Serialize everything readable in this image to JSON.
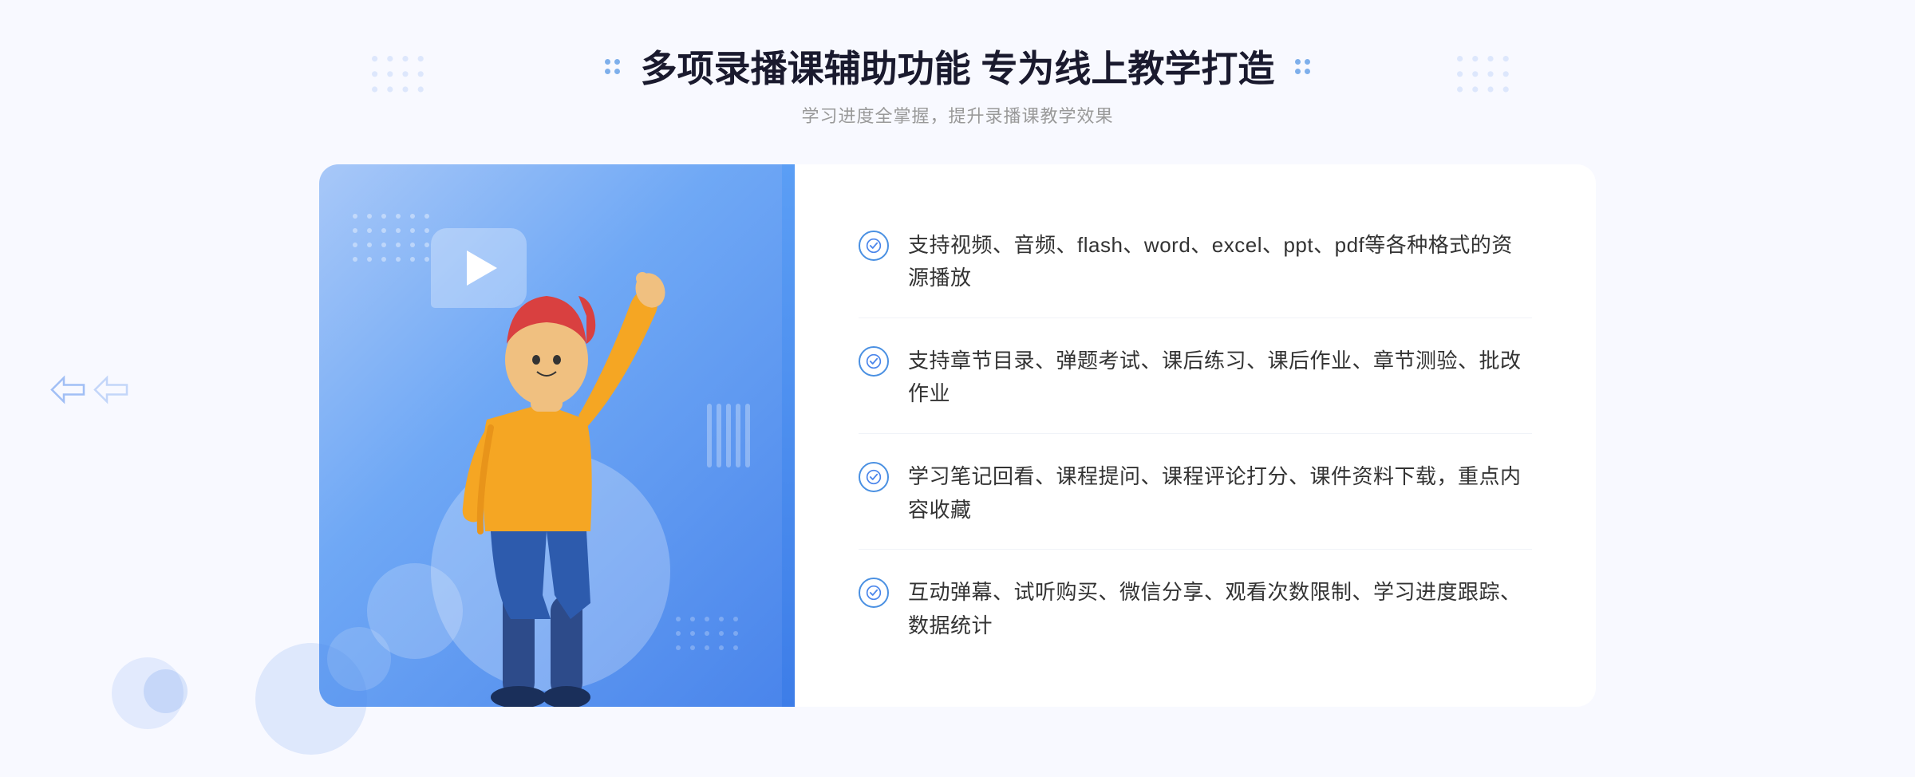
{
  "page": {
    "background_color": "#f4f7ff"
  },
  "header": {
    "main_title": "多项录播课辅助功能 专为线上教学打造",
    "subtitle": "学习进度全掌握，提升录播课教学效果"
  },
  "features": [
    {
      "id": 1,
      "text": "支持视频、音频、flash、word、excel、ppt、pdf等各种格式的资源播放"
    },
    {
      "id": 2,
      "text": "支持章节目录、弹题考试、课后练习、课后作业、章节测验、批改作业"
    },
    {
      "id": 3,
      "text": "学习笔记回看、课程提问、课程评论打分、课件资料下载，重点内容收藏"
    },
    {
      "id": 4,
      "text": "互动弹幕、试听购买、微信分享、观看次数限制、学习进度跟踪、数据统计"
    }
  ],
  "icons": {
    "check": "check-circle",
    "play": "play-button",
    "arrows": "double-chevron"
  },
  "colors": {
    "primary_blue": "#4a85eb",
    "light_blue": "#a8c8f8",
    "text_dark": "#333333",
    "text_gray": "#999999",
    "border_light": "#f0f3f8"
  }
}
